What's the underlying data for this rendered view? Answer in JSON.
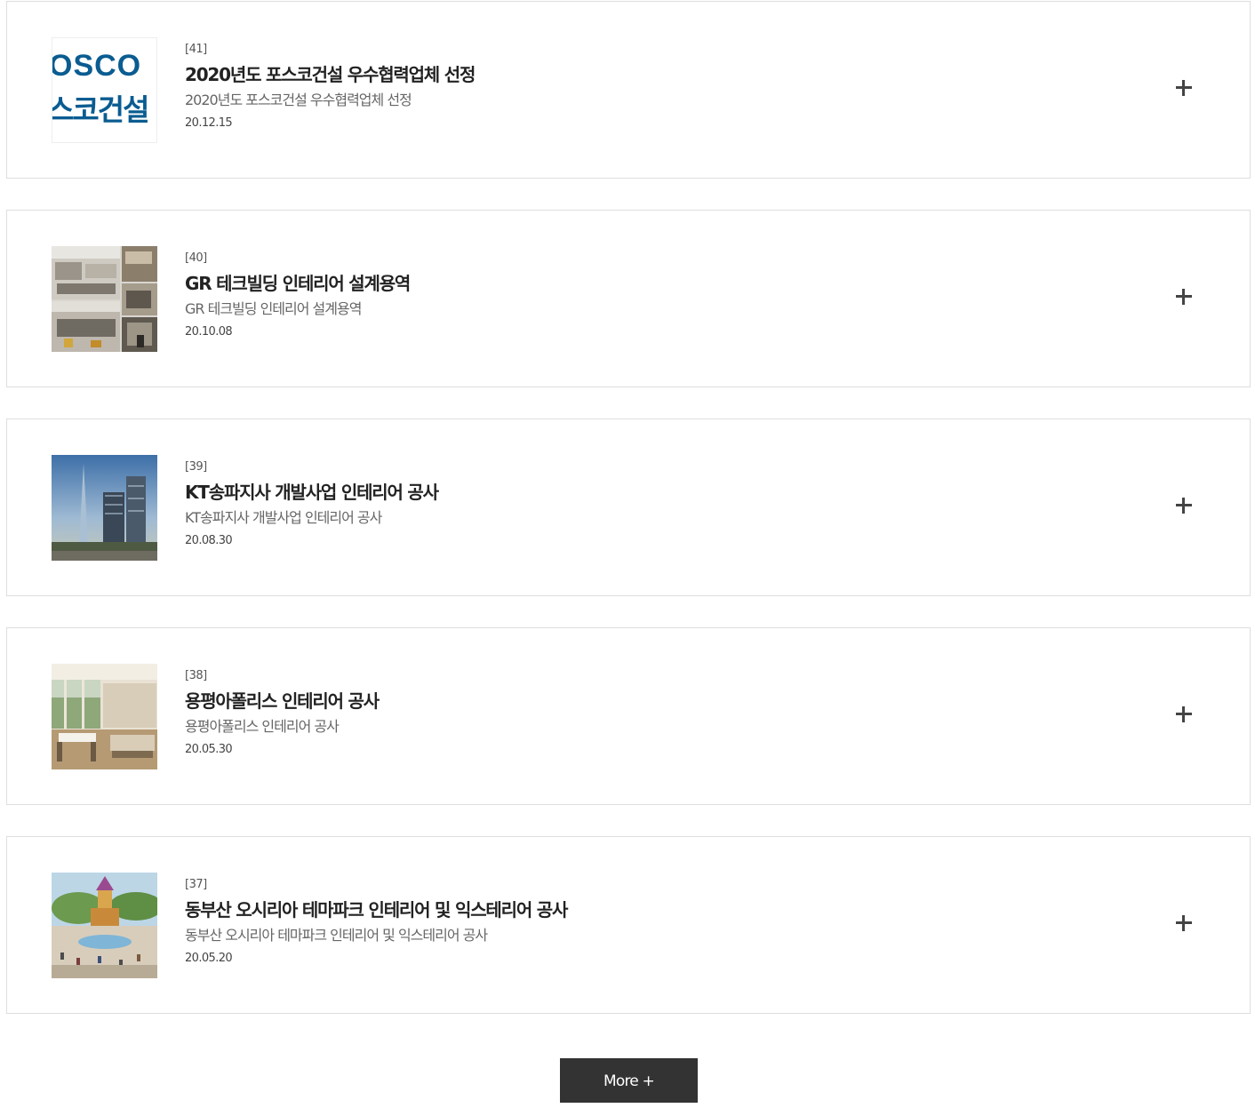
{
  "projects": [
    {
      "number": "[41]",
      "title": "2020년도 포스코건설 우수협력업체 선정",
      "subtitle": "2020년도 포스코건설 우수협력업체 선정",
      "date": "20.12.15",
      "thumb_text_top": "OSCO",
      "thumb_text_bottom": "스코건설"
    },
    {
      "number": "[40]",
      "title": "GR 테크빌딩 인테리어 설계용역",
      "subtitle": "GR 테크빌딩 인테리어 설계용역",
      "date": "20.10.08"
    },
    {
      "number": "[39]",
      "title": "KT송파지사 개발사업 인테리어 공사",
      "subtitle": "KT송파지사 개발사업 인테리어 공사",
      "date": "20.08.30"
    },
    {
      "number": "[38]",
      "title": "용평아폴리스 인테리어 공사",
      "subtitle": "용평아폴리스 인테리어 공사",
      "date": "20.05.30"
    },
    {
      "number": "[37]",
      "title": "동부산 오시리아 테마파크 인테리어 및 익스테리어 공사",
      "subtitle": "동부산 오시리아 테마파크 인테리어 및 익스테리어 공사",
      "date": "20.05.20"
    }
  ],
  "more_button": {
    "label": "More +"
  },
  "colors": {
    "posco_blue": "#0a5c91",
    "button_bg": "#333333",
    "border": "#dedede"
  }
}
